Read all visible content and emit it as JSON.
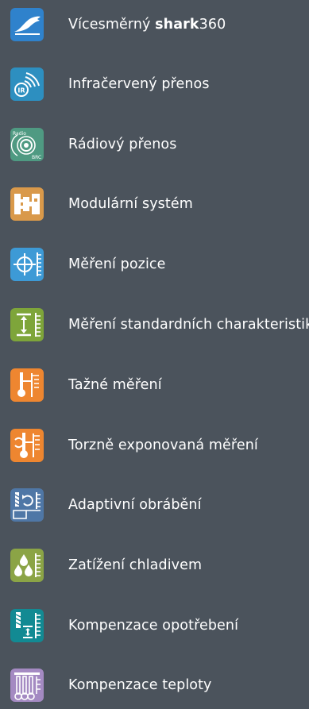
{
  "menu": {
    "items": [
      {
        "label_pre": "Vícesměrný ",
        "label_bold": "shark",
        "label_post": "360",
        "icon": "shark-icon",
        "color": "#2f82cc"
      },
      {
        "label": "Infračervený přenos",
        "icon": "infrared-transmission-icon",
        "icon_text": "IR",
        "color": "#2d8fc0"
      },
      {
        "label": "Rádiový přenos",
        "icon": "radio-transmission-icon",
        "icon_text_top": "Radio",
        "icon_text_bottom": "BRC",
        "color": "#4f9a82"
      },
      {
        "label": "Modulární systém",
        "icon": "modular-system-icon",
        "color": "#d9994a"
      },
      {
        "label": "Měření pozice",
        "icon": "position-measurement-icon",
        "color": "#3d9ad6"
      },
      {
        "label": "Měření standardních charakteristik",
        "icon": "standard-characteristics-icon",
        "color": "#7ea53a"
      },
      {
        "label": "Tažné měření",
        "icon": "tensile-measurement-icon",
        "color": "#ee8630"
      },
      {
        "label": "Torzně exponovaná měření",
        "icon": "torsion-measurement-icon",
        "color": "#ee8630"
      },
      {
        "label": "Adaptivní obrábění",
        "icon": "adaptive-machining-icon",
        "color": "#4f77a6"
      },
      {
        "label": "Zatížení chladivem",
        "icon": "coolant-load-icon",
        "color": "#8ba446"
      },
      {
        "label": "Kompenzace opotřebení",
        "icon": "wear-compensation-icon",
        "color": "#128a93"
      },
      {
        "label": "Kompenzace teploty",
        "icon": "temperature-compensation-icon",
        "color": "#a48ac2"
      }
    ]
  }
}
